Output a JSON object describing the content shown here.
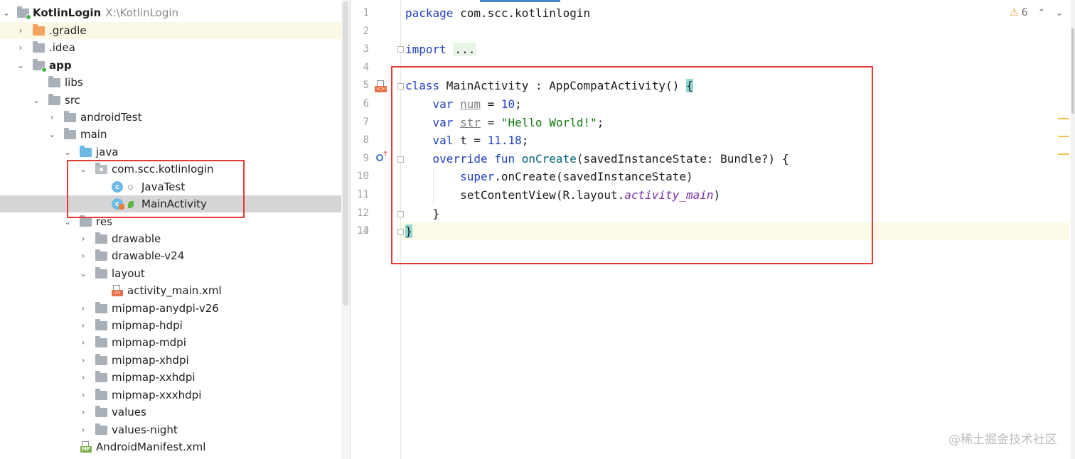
{
  "tree": {
    "project_name": "KotlinLogin",
    "project_path": "X:\\KotlinLogin",
    "items": [
      {
        "label": "KotlinLogin"
      },
      {
        "label": ".gradle"
      },
      {
        "label": ".idea"
      },
      {
        "label": "app"
      },
      {
        "label": "libs"
      },
      {
        "label": "src"
      },
      {
        "label": "androidTest"
      },
      {
        "label": "main"
      },
      {
        "label": "java"
      },
      {
        "label": "com.scc.kotlinlogin"
      },
      {
        "label": "JavaTest"
      },
      {
        "label": "MainActivity"
      },
      {
        "label": "res"
      },
      {
        "label": "drawable"
      },
      {
        "label": "drawable-v24"
      },
      {
        "label": "layout"
      },
      {
        "label": "activity_main.xml"
      },
      {
        "label": "mipmap-anydpi-v26"
      },
      {
        "label": "mipmap-hdpi"
      },
      {
        "label": "mipmap-mdpi"
      },
      {
        "label": "mipmap-xhdpi"
      },
      {
        "label": "mipmap-xxhdpi"
      },
      {
        "label": "mipmap-xxxhdpi"
      },
      {
        "label": "values"
      },
      {
        "label": "values-night"
      },
      {
        "label": "AndroidManifest.xml"
      }
    ]
  },
  "editor": {
    "warnings_count": "6",
    "line_numbers": [
      "1",
      "2",
      "3",
      "4",
      "5",
      "6",
      "7",
      "8",
      "9",
      "10",
      "11",
      "12",
      "13",
      "14"
    ],
    "code": {
      "l1_kw": "package",
      "l1_rest": " com.scc.kotlinlogin",
      "l3_kw": "import",
      "l3_fold": "...",
      "l6_kw": "class",
      "l6_rest": " MainActivity : AppCompatActivity() ",
      "l6_brace": "{",
      "var_kw": "var",
      "val_kw": "val",
      "l7_name": "num",
      "l7_eq": " = ",
      "l7_val": "10",
      "l7_end": ";",
      "l8_name": "str",
      "l8_eq": " = ",
      "l8_val": "\"Hello World!\"",
      "l8_end": ";",
      "l9_name": " t = ",
      "l9_val": "11.18",
      "l9_end": ";",
      "l10_kw": "override fun",
      "l10_fn": "onCreate",
      "l10_rest": "(savedInstanceState: Bundle?) {",
      "l11_kw": "super",
      "l11_fn": ".onCreate",
      "l11_rest": "(savedInstanceState)",
      "l12_a": "setContentView(R.layout.",
      "l12_it": "activity_main",
      "l12_b": ")",
      "l13": "}",
      "l14": "}"
    }
  },
  "icons": {
    "folder": "folder-icon",
    "class": "kotlin-class-icon",
    "xml": "xml-file-icon",
    "manifest": "manifest-icon",
    "warning": "warning-icon"
  },
  "colors": {
    "keyword": "#1f3fbf",
    "string": "#107a10",
    "selection": "#d5d5d5",
    "highlight_box": "#e53935"
  },
  "watermark": "@稀土掘金技术社区"
}
